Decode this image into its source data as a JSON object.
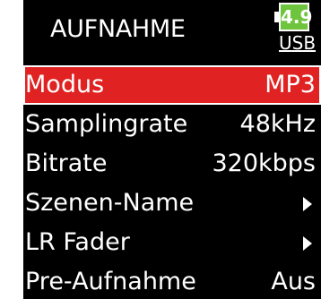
{
  "header": {
    "title": "AUFNAHME",
    "battery": {
      "level": "4.9",
      "source": "USB",
      "icon": "battery-icon",
      "color": "#6fc43d"
    }
  },
  "menu": {
    "items": [
      {
        "label": "Modus",
        "value": "MP3",
        "selected": true
      },
      {
        "label": "Samplingrate",
        "value": "48kHz"
      },
      {
        "label": "Bitrate",
        "value": "320kbps"
      },
      {
        "label": "Szenen-Name",
        "icon": "arrow-right-icon"
      },
      {
        "label": "LR Fader",
        "icon": "arrow-right-icon"
      },
      {
        "label": "Pre-Aufnahme",
        "value": "Aus"
      }
    ]
  },
  "colors": {
    "background": "#000000",
    "selected": "#e02222",
    "text": "#ffffff"
  }
}
